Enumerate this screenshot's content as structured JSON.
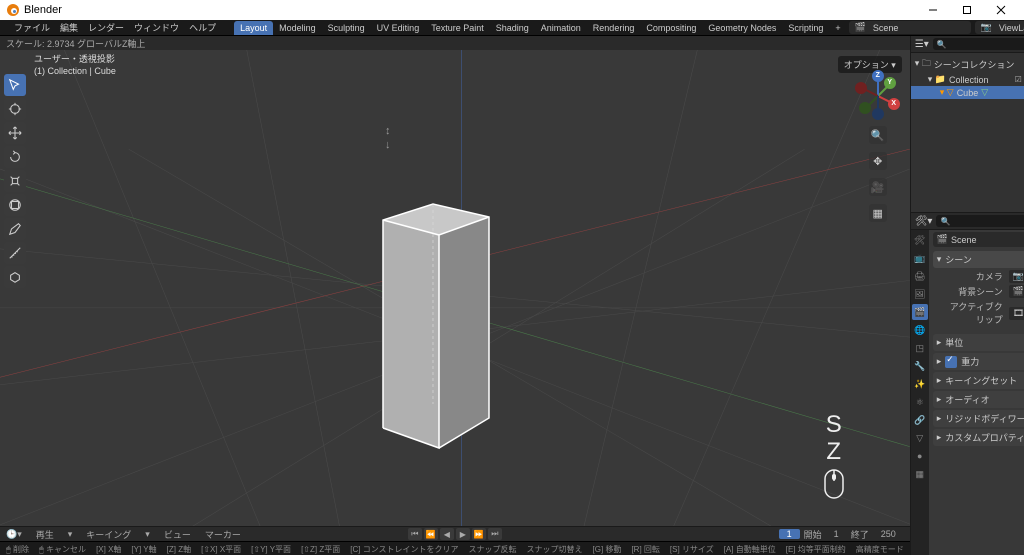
{
  "title": "Blender",
  "menus": [
    "ファイル",
    "編集",
    "レンダー",
    "ウィンドウ",
    "ヘルプ"
  ],
  "workspaces": [
    "Layout",
    "Modeling",
    "Sculpting",
    "UV Editing",
    "Texture Paint",
    "Shading",
    "Animation",
    "Rendering",
    "Compositing",
    "Geometry Nodes",
    "Scripting",
    "+"
  ],
  "active_workspace": "Layout",
  "scene_name": "Scene",
  "viewlayer_name": "ViewLayer",
  "transform_status": "スケール: 2.9734  グローバルZ軸上",
  "overlay": {
    "line1": "ユーザー・透視投影",
    "line2": "(1) Collection | Cube"
  },
  "options_btn": "オプション",
  "timeline": {
    "play_label": "再生",
    "keying": "キーイング",
    "view": "ビュー",
    "marker": "マーカー",
    "current": "1",
    "start_label": "開始",
    "start": "1",
    "end_label": "終了",
    "end": "250"
  },
  "statusbar": [
    "削除",
    "キャンセル",
    "X軸",
    "Y軸",
    "Z軸",
    "X平面",
    "Y平面",
    "Z平面",
    "コンストレイントをクリア",
    "スナップ反転",
    "スナップ切替え",
    "移動",
    "回転",
    "リサイズ",
    "自動軸単位",
    "均等平面制約",
    "高精度モード"
  ],
  "status_keys": [
    "[X]",
    "[Y]",
    "[Z]",
    "[⇧X]",
    "[⇧Y]",
    "[⇧Z]",
    "[C]",
    "",
    "",
    "[G]",
    "[R]",
    "[S]",
    "[A]",
    "[E]",
    ""
  ],
  "outliner": {
    "root": "シーンコレクション",
    "collection": "Collection",
    "object": "Cube"
  },
  "props": {
    "breadcrumb": "Scene",
    "panel_scene": "シーン",
    "camera": "カメラ",
    "bgscene": "背景シーン",
    "activeclip": "アクティブクリップ",
    "units": "単位",
    "gravity": "重力",
    "keyingsets": "キーイングセット",
    "audio": "オーディオ",
    "rigidbody": "リジッドボディワールド",
    "custom": "カスタムプロパティ"
  }
}
